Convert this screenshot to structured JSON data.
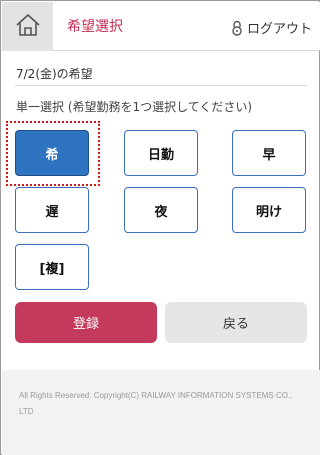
{
  "header": {
    "home_icon": "home-icon",
    "title": "希望選択",
    "logout_icon": "lock-icon",
    "logout_label": "ログアウト"
  },
  "main": {
    "date_line": "7/2(金)の希望",
    "instruction": "単一選択 (希望勤務を1つ選択してください)",
    "options": [
      {
        "label": "希",
        "selected": true
      },
      {
        "label": "日勤",
        "selected": false
      },
      {
        "label": "早",
        "selected": false
      },
      {
        "label": "遅",
        "selected": false
      },
      {
        "label": "夜",
        "selected": false
      },
      {
        "label": "明け",
        "selected": false
      },
      {
        "label": "[複]",
        "selected": false
      }
    ],
    "register_label": "登録",
    "back_label": "戻る"
  },
  "footer": {
    "copyright": "All Rights Reserved. Copyright(C) RAILWAY INFORMATION SYSTEMS CO., LTD"
  },
  "colors": {
    "accent": "#c62d52",
    "selected_option": "#2e74c0",
    "option_border": "#3a6fbf",
    "register_button": "#c43a5c",
    "back_button": "#e6e6e6"
  }
}
